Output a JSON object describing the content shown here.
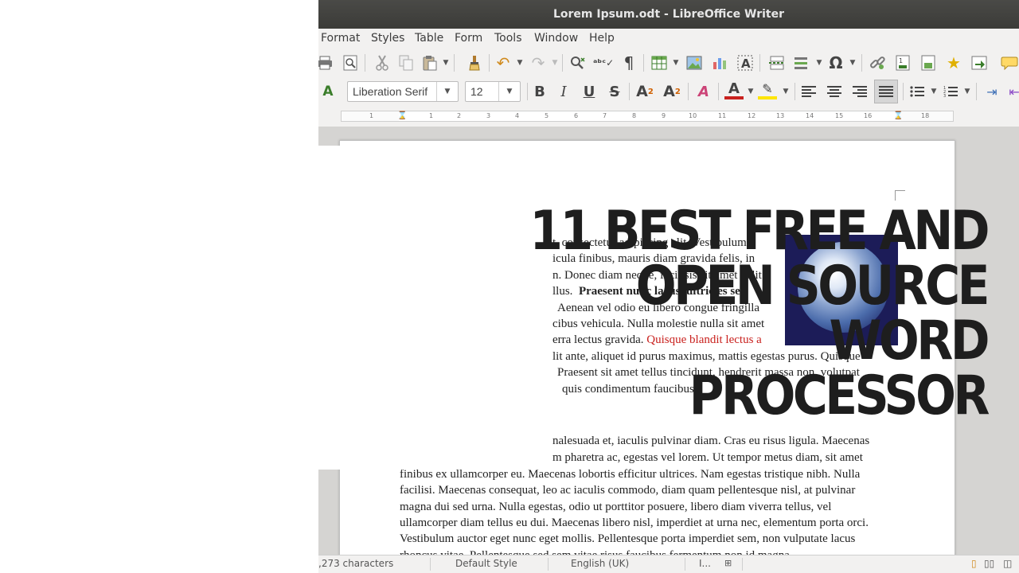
{
  "window": {
    "title": "Lorem Ipsum.odt - LibreOffice Writer"
  },
  "menu": [
    "Format",
    "Styles",
    "Table",
    "Form",
    "Tools",
    "Window",
    "Help"
  ],
  "formatting": {
    "font_name": "Liberation Serif",
    "font_size": "12"
  },
  "ruler": {
    "labels": [
      "1",
      "1",
      "2",
      "3",
      "4",
      "5",
      "6",
      "7",
      "8",
      "9",
      "10",
      "11",
      "12",
      "13",
      "14",
      "15",
      "16",
      "17",
      "18"
    ]
  },
  "document": {
    "paragraph1": [
      "t, consectetur adipiscing elit. Vestibulum",
      "icula finibus, mauris diam gravida felis, in",
      "n. Donec diam neque, facilisis sit amet velit",
      "llus.",
      "Praesent nunc lacus, ultricies sed",
      "Aenean vel odio eu libero congue fringilla",
      "cibus vehicula. Nulla molestie nulla sit amet",
      "erra lectus gravida.",
      "Quisque blandit lectus a",
      "lit ante, aliquet id purus maximus, mattis egestas purus. Quisque",
      "Praesent sit amet tellus tincidunt, hendrerit massa non, volutpat",
      "quis condimentum faucibus."
    ],
    "paragraph2": [
      "nalesuada et, iaculis pulvinar diam. Cras eu risus ligula. Maecenas",
      "m pharetra ac, egestas vel lorem. Ut tempor metus diam, sit amet",
      "finibus ex ullamcorper eu. Maecenas lobortis efficitur ultrices. Nam egestas tristique nibh. Nulla",
      "facilisi. Maecenas consequat, leo ac iaculis commodo, diam quam pellentesque nisl, at pulvinar",
      "magna dui sed urna. Nulla egestas, odio ut porttitor posuere, libero diam viverra tellus, vel",
      "ullamcorper diam tellus eu dui. Maecenas libero nisl, imperdiet at urna nec, elementum porta orci.",
      "Vestibulum auctor eget nunc eget mollis. Pellentesque porta imperdiet sem, non vulputate lacus",
      "rhoncus vitae. Pellentesque sed sem vitae risus faucibus fermentum non id magna."
    ]
  },
  "statusbar": {
    "characters": ",273 characters",
    "page_style": "Default Style",
    "language": "English (UK)",
    "insert_mode": "I..."
  },
  "headline": {
    "lines": [
      "11 BEST FREE AND",
      "OPEN SOURCE",
      "WORD",
      "PROCESSOR"
    ]
  },
  "icons": [
    "print-icon",
    "print-preview-icon",
    "cut-icon",
    "copy-icon",
    "paste-icon",
    "clone-formatting-icon",
    "undo-icon",
    "redo-icon",
    "find-replace-icon",
    "spelling-icon",
    "formatting-marks-icon",
    "insert-table-icon",
    "insert-image-icon",
    "insert-chart-icon",
    "insert-textbox-icon",
    "insert-page-break-icon",
    "insert-field-icon",
    "special-character-icon",
    "hyperlink-icon",
    "footnote-icon",
    "endnote-icon",
    "bookmark-icon",
    "cross-reference-icon",
    "comment-icon",
    "styles-icon",
    "bold-icon",
    "italic-icon",
    "underline-icon",
    "strikethrough-icon",
    "superscript-icon",
    "subscript-icon",
    "clear-formatting-icon",
    "font-color-icon",
    "highlight-icon",
    "align-left-icon",
    "align-center-icon",
    "align-right-icon",
    "justify-icon",
    "bullets-icon",
    "numbering-icon",
    "increase-indent-icon",
    "decrease-indent-icon"
  ]
}
